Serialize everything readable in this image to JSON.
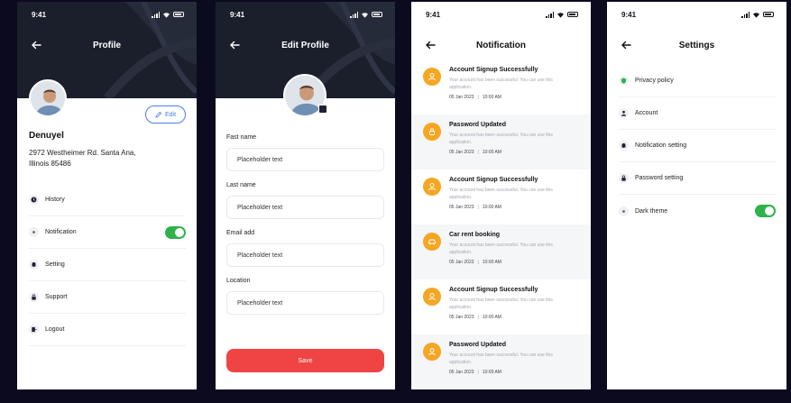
{
  "status_time": "9:41",
  "profile": {
    "title": "Profile",
    "edit_label": "Edit",
    "name": "Denuyel",
    "address": "2972 Westheimer Rd. Santa Ana, Illinois 85486",
    "menu": [
      {
        "label": "History",
        "icon": "clock-icon"
      },
      {
        "label": "Notification",
        "icon": "bell-icon",
        "toggle": true
      },
      {
        "label": "Setting",
        "icon": "gear-icon"
      },
      {
        "label": "Support",
        "icon": "lock-icon"
      },
      {
        "label": "Logout",
        "icon": "logout-icon"
      }
    ]
  },
  "edit_profile": {
    "title": "Edit Profile",
    "fields": [
      {
        "label": "Fast name",
        "value": "Placeholder text"
      },
      {
        "label": "Last name",
        "value": "Placeholder text"
      },
      {
        "label": "Email add",
        "value": "Placeholder text"
      },
      {
        "label": "Location",
        "value": "Placeholder text"
      }
    ],
    "save_label": "Save"
  },
  "notification": {
    "title": "Notification",
    "items": [
      {
        "title": "Account Signup Successfully",
        "body": "Your account has been successful. You can use this application.",
        "date": "05 Jan 2023",
        "time": "10:00 AM",
        "icon": "user-icon"
      },
      {
        "title": "Password Updated",
        "body": "Your account has been successful. You can use this application.",
        "date": "05 Jan 2023",
        "time": "10:00 AM",
        "icon": "lock-icon"
      },
      {
        "title": "Account Signup Successfully",
        "body": "Your account has been successful. You can use this application.",
        "date": "05 Jan 2023",
        "time": "10:00 AM",
        "icon": "user-icon"
      },
      {
        "title": "Car rent booking",
        "body": "Your account has been successful. You can use this application.",
        "date": "05 Jan 2023",
        "time": "10:00 AM",
        "icon": "car-icon"
      },
      {
        "title": "Account Signup Successfully",
        "body": "Your account has been successful. You can use this application.",
        "date": "05 Jan 2023",
        "time": "10:00 AM",
        "icon": "user-icon"
      },
      {
        "title": "Password Updated",
        "body": "Your account has been successful. You can use this application.",
        "date": "05 Jan 2023",
        "time": "10:00 AM",
        "icon": "user-icon"
      }
    ]
  },
  "settings": {
    "title": "Settings",
    "items": [
      {
        "label": "Privacy policy",
        "icon": "shield-icon"
      },
      {
        "label": "Account",
        "icon": "person-icon"
      },
      {
        "label": "Notification setting",
        "icon": "bell-icon"
      },
      {
        "label": "Password setting",
        "icon": "lock-icon"
      },
      {
        "label": "Dark theme",
        "icon": "sun-icon",
        "toggle": true
      }
    ]
  },
  "colors": {
    "accent_red": "#f04444",
    "accent_blue": "#4a7df0",
    "toggle_green": "#2fb24a",
    "notification_orange": "#f5a623",
    "header_dark": "#1b1f2c"
  }
}
